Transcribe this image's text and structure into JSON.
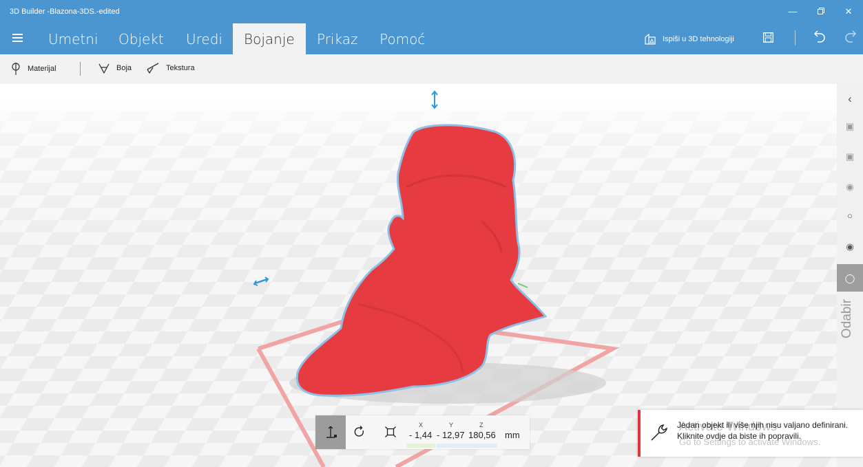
{
  "window": {
    "title": "3D Builder -Blazona-3DS.-edited",
    "controls": [
      "minimize-icon",
      "restore-icon",
      "close-icon"
    ]
  },
  "menu": {
    "tabs": [
      {
        "label": "Umetni"
      },
      {
        "label": "Objekt"
      },
      {
        "label": "Uredi"
      },
      {
        "label": "Bojanje",
        "active": true
      },
      {
        "label": "Prikaz"
      },
      {
        "label": "Pomoć"
      }
    ],
    "print_label": "Ispiši u 3D tehnologiji"
  },
  "toolbar": {
    "material_label": "Materijal",
    "color_label": "Boja",
    "texture_label": "Tekstura"
  },
  "right_panel": {
    "label": "Odabir"
  },
  "transform": {
    "headers": {
      "x": "X",
      "y": "Y",
      "z": "Z"
    },
    "values": {
      "x": "- 1,44",
      "y": "- 12,97",
      "z": "180,56"
    },
    "unit": "mm"
  },
  "notification": {
    "text": "Jedan objekt ili više njih nisu valjano definirani. Kliknite ovdje da biste ih popravili."
  },
  "watermark": {
    "line1": "Activate Windows",
    "line2": "Go to Settings to activate Windows."
  },
  "colors": {
    "accent": "#4b96d1",
    "model": "#e53b41",
    "model_outline": "#8fbfe6",
    "warning": "#e0343e"
  }
}
